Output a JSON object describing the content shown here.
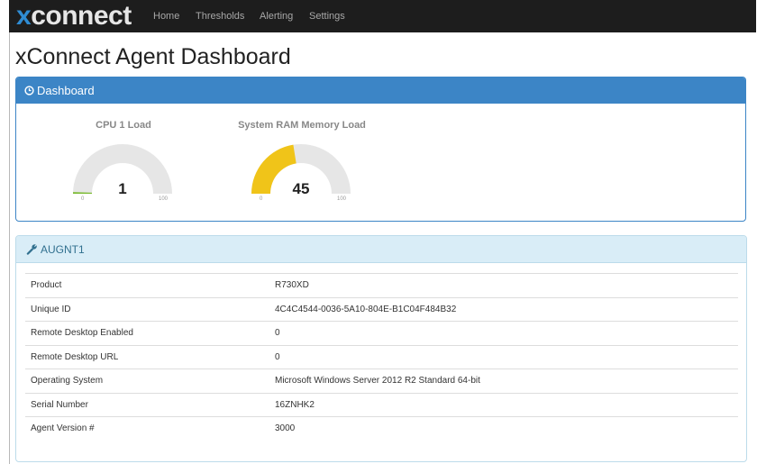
{
  "brand": {
    "prefix": "x",
    "rest": "connect"
  },
  "nav": [
    {
      "label": "Home"
    },
    {
      "label": "Thresholds"
    },
    {
      "label": "Alerting"
    },
    {
      "label": "Settings"
    }
  ],
  "page_title": "xConnect Agent Dashboard",
  "dashboard": {
    "header": "Dashboard",
    "header_icon": "clock-icon",
    "gauges": [
      {
        "title": "CPU 1 Load",
        "value": "1",
        "level": 1,
        "min": "0",
        "max": "100",
        "color": "#76b82a"
      },
      {
        "title": "System RAM Memory Load",
        "value": "45",
        "level": 45,
        "min": "0",
        "max": "100",
        "color": "#f0c419"
      }
    ],
    "track_color": "#e6e6e6"
  },
  "agent": {
    "header": "AUGNT1",
    "header_icon": "wrench-icon",
    "rows": [
      {
        "key": "Product",
        "value": "R730XD"
      },
      {
        "key": "Unique ID",
        "value": "4C4C4544-0036-5A10-804E-B1C04F484B32"
      },
      {
        "key": "Remote Desktop Enabled",
        "value": "0"
      },
      {
        "key": "Remote Desktop URL",
        "value": "0"
      },
      {
        "key": "Operating System",
        "value": "Microsoft Windows Server 2012 R2 Standard 64-bit"
      },
      {
        "key": "Serial Number",
        "value": "16ZNHK2"
      },
      {
        "key": "Agent Version #",
        "value": "3000"
      }
    ]
  },
  "colors": {
    "navbar_bg": "#1d1d1d",
    "brand_accent": "#2f8cd3",
    "primary": "#3c85c6",
    "info_bg": "#d9edf7",
    "info_text": "#31708f"
  }
}
